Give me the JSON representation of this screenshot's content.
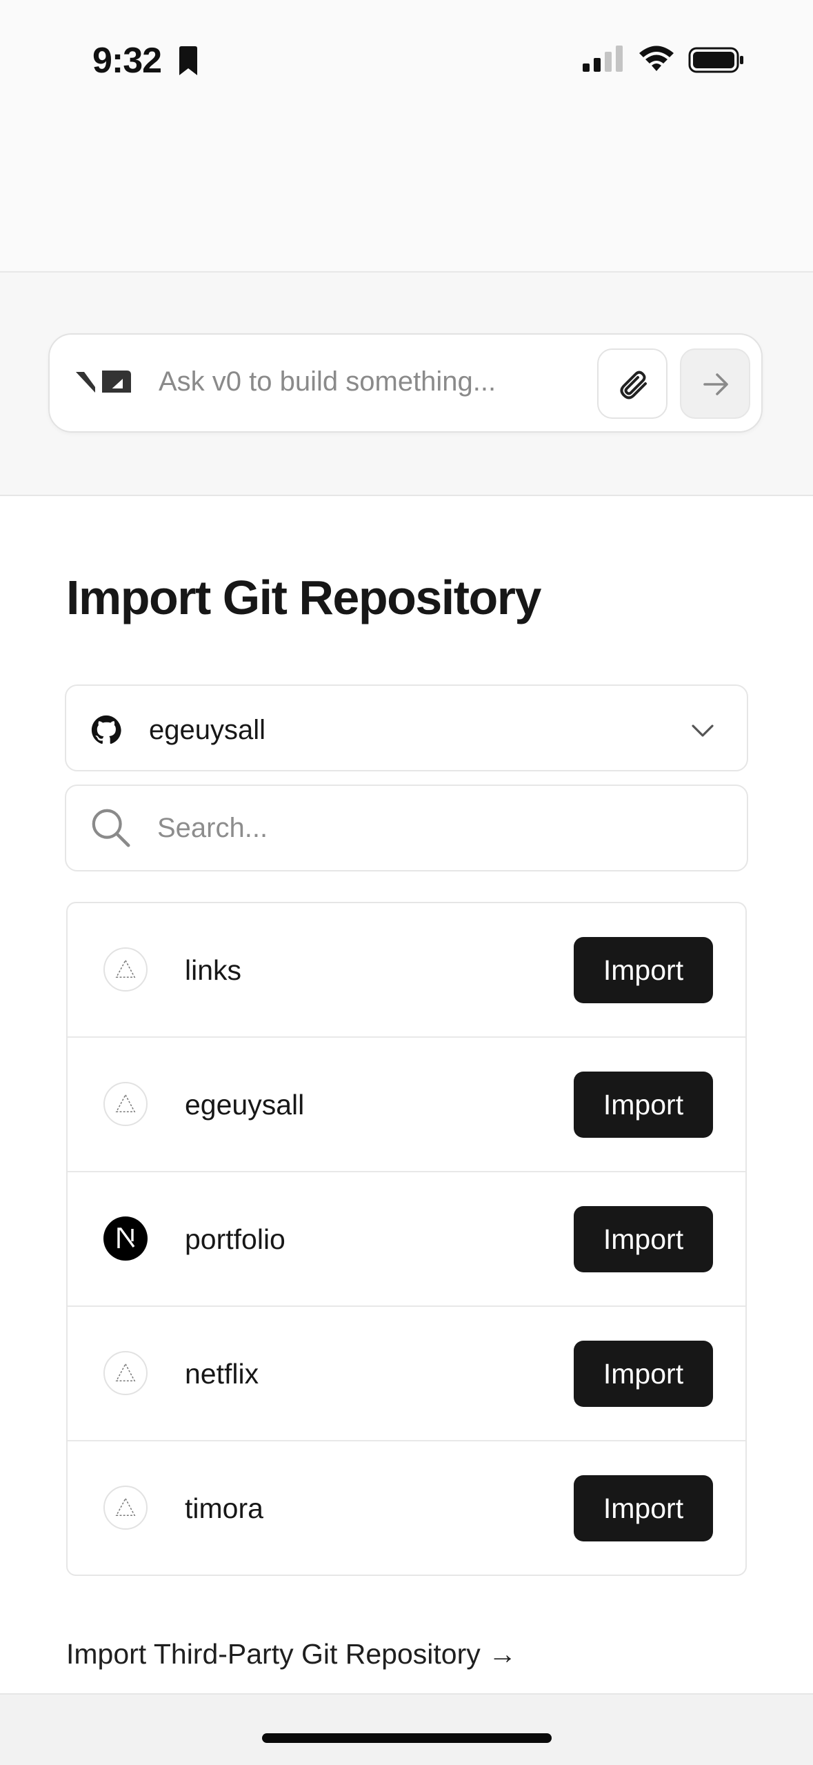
{
  "status_bar": {
    "time": "9:32",
    "icons": [
      "bookmark-icon",
      "signal-icon",
      "wifi-icon",
      "battery-icon"
    ]
  },
  "prompt": {
    "logo": "v0-logo",
    "placeholder": "Ask v0 to build something...",
    "attach_icon": "paperclip-icon",
    "send_icon": "arrow-right-icon"
  },
  "page": {
    "title": "Import Git Repository"
  },
  "account_select": {
    "provider_icon": "github-icon",
    "selected": "egeuysall",
    "chevron": "chevron-down-icon"
  },
  "search": {
    "placeholder": "Search...",
    "value": ""
  },
  "repositories": [
    {
      "name": "links",
      "icon": "vercel-triangle-icon",
      "action": "Import"
    },
    {
      "name": "egeuysall",
      "icon": "vercel-triangle-icon",
      "action": "Import"
    },
    {
      "name": "portfolio",
      "icon": "nextjs-icon",
      "action": "Import"
    },
    {
      "name": "netflix",
      "icon": "vercel-triangle-icon",
      "action": "Import"
    },
    {
      "name": "timora",
      "icon": "vercel-triangle-icon",
      "action": "Import"
    }
  ],
  "third_party_link": "Import Third-Party Git Repository →",
  "colors": {
    "button_bg": "#171717",
    "button_text": "#ffffff",
    "border": "#e6e6e6",
    "placeholder": "#8a8a8a"
  }
}
